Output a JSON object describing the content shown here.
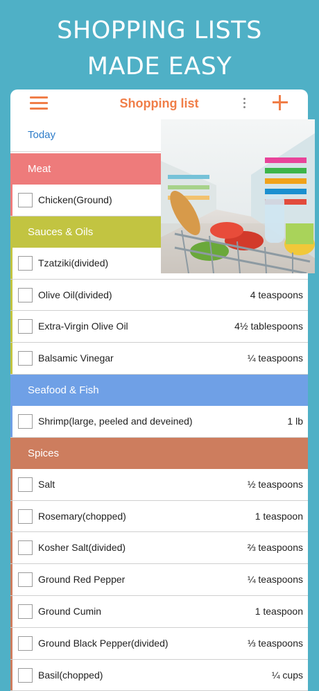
{
  "headline": {
    "line1": "SHOPPING LISTS",
    "line2": "MADE EASY"
  },
  "appbar": {
    "title": "Shopping list",
    "menu_icon": "hamburger-icon",
    "more_icon": "kebab-icon",
    "add_icon": "plus-icon"
  },
  "date": {
    "label": "Today"
  },
  "colors": {
    "accent": "#f07e48",
    "meat": "#ee7b7b",
    "sauces": "#c2c441",
    "seafood": "#6fa0e6",
    "spices": "#cd7d5e",
    "background": "#4fb0c6"
  },
  "categories": [
    {
      "name": "Meat",
      "items": [
        {
          "name": "Chicken(Ground)",
          "qty": ""
        }
      ]
    },
    {
      "name": "Sauces & Oils",
      "items": [
        {
          "name": "Tzatziki(divided)",
          "qty": ""
        },
        {
          "name": "Olive Oil(divided)",
          "qty": "4 teaspoons"
        },
        {
          "name": "Extra-Virgin Olive Oil",
          "qty": "4½ tablespoons"
        },
        {
          "name": "Balsamic Vinegar",
          "qty": "¼ teaspoons"
        }
      ]
    },
    {
      "name": "Seafood & Fish",
      "items": [
        {
          "name": "Shrimp(large, peeled and deveined)",
          "qty": "1 lb"
        }
      ]
    },
    {
      "name": "Spices",
      "items": [
        {
          "name": "Salt",
          "qty": "½ teaspoons"
        },
        {
          "name": "Rosemary(chopped)",
          "qty": "1 teaspoon"
        },
        {
          "name": "Kosher Salt(divided)",
          "qty": "⅔ teaspoons"
        },
        {
          "name": "Ground Red Pepper",
          "qty": "¼ teaspoons"
        },
        {
          "name": "Ground Cumin",
          "qty": "1 teaspoon"
        },
        {
          "name": "Ground Black Pepper(divided)",
          "qty": "⅓ teaspoons"
        },
        {
          "name": "Basil(chopped)",
          "qty": "¼ cups"
        }
      ]
    }
  ]
}
